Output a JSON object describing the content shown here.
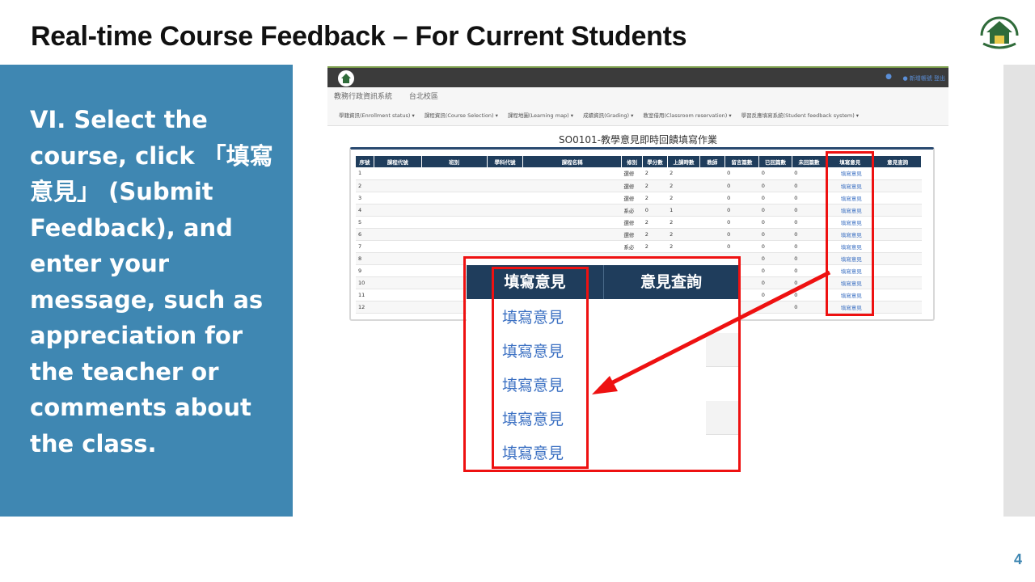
{
  "slide": {
    "title": "Real-time Course Feedback – For Current Students",
    "instruction": "VI. Select the course, click 「填寫意見」 (Submit Feedback), and enter your message, such as appreciation for the teacher or comments about the class.",
    "page_number": "4"
  },
  "screenshot": {
    "system_name": "教務行政資訊系統",
    "campus": "台北校區",
    "user_links": "● 新增帳號  登出",
    "menu": [
      "學籍資訊(Enrollment status) ▾",
      "課程資訊(Course Selection) ▾",
      "課程地圖(Learning map) ▾",
      "成績資訊(Grading) ▾",
      "教室借用(Classroom reservation) ▾",
      "學習反應填寫系統(Student feedback system) ▾"
    ],
    "page_heading": "SO0101-教學意見即時回饋填寫作業",
    "table_headers": [
      "序號",
      "課程代號",
      "班別",
      "學科代號",
      "課程名稱",
      "修別",
      "學分數",
      "上課時數",
      "教師",
      "留言篇數",
      "已回篇數",
      "未回篇數",
      "填寫意見",
      "意見查詢"
    ],
    "rows": [
      {
        "no": "1",
        "type": "選修",
        "credits": "2",
        "hours": "2",
        "msgs": "0",
        "replied": "0",
        "unreplied": "0",
        "link": "填寫意見"
      },
      {
        "no": "2",
        "type": "選修",
        "credits": "2",
        "hours": "2",
        "msgs": "0",
        "replied": "0",
        "unreplied": "0",
        "link": "填寫意見"
      },
      {
        "no": "3",
        "type": "選修",
        "credits": "2",
        "hours": "2",
        "msgs": "0",
        "replied": "0",
        "unreplied": "0",
        "link": "填寫意見"
      },
      {
        "no": "4",
        "type": "系必",
        "credits": "0",
        "hours": "1",
        "msgs": "0",
        "replied": "0",
        "unreplied": "0",
        "link": "填寫意見"
      },
      {
        "no": "5",
        "type": "選修",
        "credits": "2",
        "hours": "2",
        "msgs": "0",
        "replied": "0",
        "unreplied": "0",
        "link": "填寫意見"
      },
      {
        "no": "6",
        "type": "選修",
        "credits": "2",
        "hours": "2",
        "msgs": "0",
        "replied": "0",
        "unreplied": "0",
        "link": "填寫意見"
      },
      {
        "no": "7",
        "type": "系必",
        "credits": "2",
        "hours": "2",
        "msgs": "0",
        "replied": "0",
        "unreplied": "0",
        "link": "填寫意見"
      },
      {
        "no": "8",
        "type": "",
        "credits": "",
        "hours": "",
        "msgs": "",
        "replied": "0",
        "unreplied": "0",
        "link": "填寫意見"
      },
      {
        "no": "9",
        "type": "",
        "credits": "",
        "hours": "",
        "msgs": "",
        "replied": "0",
        "unreplied": "0",
        "link": "填寫意見"
      },
      {
        "no": "10",
        "type": "",
        "credits": "",
        "hours": "",
        "msgs": "",
        "replied": "0",
        "unreplied": "0",
        "link": "填寫意見"
      },
      {
        "no": "11",
        "type": "",
        "credits": "",
        "hours": "",
        "msgs": "",
        "replied": "0",
        "unreplied": "0",
        "link": "填寫意見"
      },
      {
        "no": "12",
        "type": "",
        "credits": "",
        "hours": "",
        "msgs": "",
        "replied": "",
        "unreplied": "0",
        "link": "填寫意見"
      }
    ]
  },
  "zoom": {
    "header_submit": "填寫意見",
    "header_query": "意見查詢",
    "links": [
      "填寫意見",
      "填寫意見",
      "填寫意見",
      "填寫意見",
      "填寫意見"
    ]
  },
  "colors": {
    "panel": "#3f87b2",
    "table_header": "#1f3d5c",
    "highlight": "#ee1111",
    "link": "#3a6fc2"
  }
}
